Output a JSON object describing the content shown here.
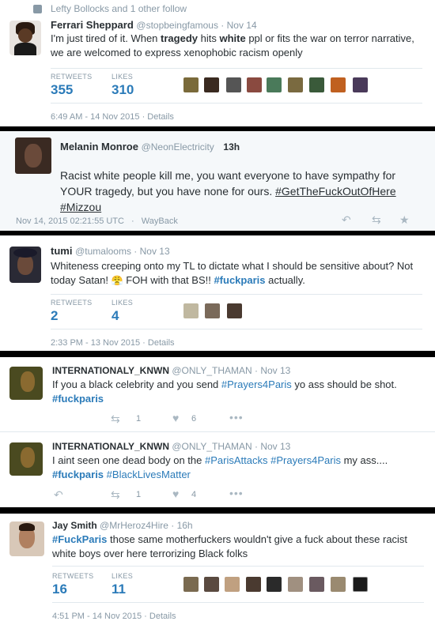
{
  "t1": {
    "follow_notice": "Lefty Bollocks and 1 other follow",
    "name": "Ferrari Sheppard",
    "handle": "@stopbeingfamous · Nov 14",
    "text_a": "I'm just tired of it. When ",
    "text_b": "tragedy",
    "text_c": " hits ",
    "text_d": "white",
    "text_e": " ppl or fits the war on terror narrative, we are welcomed to express xenophobic racism openly",
    "retweets_label": "RETWEETS",
    "retweets": "355",
    "likes_label": "LIKES",
    "likes": "310",
    "timestamp": "6:49 AM - 14 Nov 2015 · Details"
  },
  "t2": {
    "name": "Melanin Monroe",
    "handle": "@NeonElectricity",
    "time": "13h",
    "text_a": "Racist white people kill me, you want everyone to have sympathy for YOUR tragedy, but you have none for ours. ",
    "tag": "#GetTheFuckOutOfHere #Mizzou",
    "footer": "Nov 14, 2015 02:21:55 UTC",
    "wayback": "WayBack"
  },
  "t3": {
    "name": "tumi",
    "handle": "@tumalooms · Nov 13",
    "text_a": "Whiteness creeping onto my TL to dictate what I should be sensitive about? Not today Satan! ",
    "emoji": "😤",
    "text_b": " FOH with that BS!! ",
    "tag": "#fuckparis",
    "text_c": " actually.",
    "retweets_label": "RETWEETS",
    "retweets": "2",
    "likes_label": "LIKES",
    "likes": "4",
    "timestamp": "2:33 PM - 13 Nov 2015 · Details"
  },
  "t4": {
    "name": "INTERNATIONALY_KNWN",
    "handle": "@ONLY_THAMAN · Nov 13",
    "text_a": "If you a black celebrity and you send ",
    "tag1": "#Prayers4Paris",
    "text_b": " yo ass should be shot.",
    "tag2": "#fuckparis",
    "rt_count": "1",
    "like_count": "6"
  },
  "t5": {
    "name": "INTERNATIONALY_KNWN",
    "handle": "@ONLY_THAMAN · Nov 13",
    "text_a": "I aint seen one dead body on the ",
    "tag1": "#ParisAttacks",
    "tag2": "#Prayers4Paris",
    "text_b": " my ass....",
    "tag3": "#fuckparis",
    "tag4": "#BlackLivesMatter",
    "rt_count": "1",
    "like_count": "4"
  },
  "t6": {
    "name": "Jay Smith",
    "handle": "@MrHeroz4Hire · 16h",
    "tag": "#FuckParis",
    "text_a": " those same motherfuckers wouldn't give a fuck about these racist white boys over here terrorizing Black folks",
    "retweets_label": "RETWEETS",
    "retweets": "16",
    "likes_label": "LIKES",
    "likes": "11",
    "timestamp": "4:51 PM - 14 Nov 2015 · Details"
  },
  "icons": [
    "follow-person-icon",
    "reply-icon",
    "retweet-icon",
    "star-icon",
    "heart-icon",
    "more-icon"
  ],
  "colors": {
    "link": "#2b7bb9",
    "muted": "#8899a6",
    "text": "#292f33",
    "divider": "#000000"
  }
}
